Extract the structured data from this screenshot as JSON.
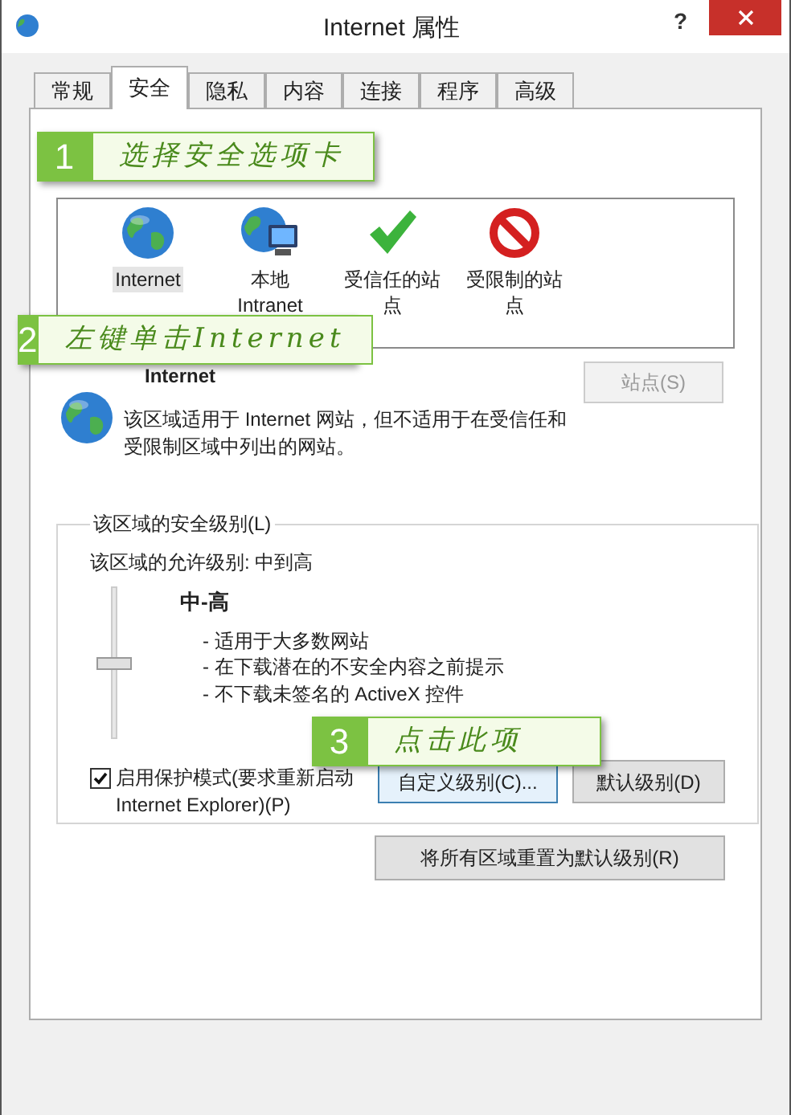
{
  "window": {
    "title": "Internet 属性",
    "help_button": "?"
  },
  "tabs": [
    {
      "label": "常规",
      "selected": false
    },
    {
      "label": "安全",
      "selected": true
    },
    {
      "label": "隐私",
      "selected": false
    },
    {
      "label": "内容",
      "selected": false
    },
    {
      "label": "连接",
      "selected": false
    },
    {
      "label": "程序",
      "selected": false
    },
    {
      "label": "高级",
      "selected": false
    }
  ],
  "zones": [
    {
      "kind": "globe",
      "label": "Internet",
      "selected": true
    },
    {
      "kind": "intranet",
      "label": "本地 Intranet",
      "selected": false
    },
    {
      "kind": "trusted",
      "label": "受信任的站点",
      "selected": false
    },
    {
      "kind": "restricted",
      "label": "受限制的站点",
      "selected": false
    }
  ],
  "zone_info": {
    "name": "Internet",
    "description": "该区域适用于 Internet 网站，但不适用于在受信任和受限制区域中列出的网站。",
    "sites_button": {
      "label": "站点(S)",
      "disabled": true
    }
  },
  "security_level": {
    "group_title": "该区域的安全级别(L)",
    "allowed": "该区域的允许级别: 中到高",
    "level": 0.5,
    "level_name": "中-高",
    "bullets": [
      "- 适用于大多数网站",
      "- 在下载潜在的不安全内容之前提示",
      "- 不下载未签名的 ActiveX 控件"
    ]
  },
  "protected_mode": {
    "label": "启用保护模式(要求重新启动 Internet Explorer)(P)",
    "checked": true
  },
  "buttons": {
    "custom_level": "自定义级别(C)...",
    "default_level": "默认级别(D)",
    "reset_all": "将所有区域重置为默认级别(R)"
  },
  "callouts": [
    {
      "number": "1",
      "text": "选择安全选项卡"
    },
    {
      "number": "2",
      "text": "左键单击Internet"
    },
    {
      "number": "3",
      "text": "点击此项"
    }
  ]
}
